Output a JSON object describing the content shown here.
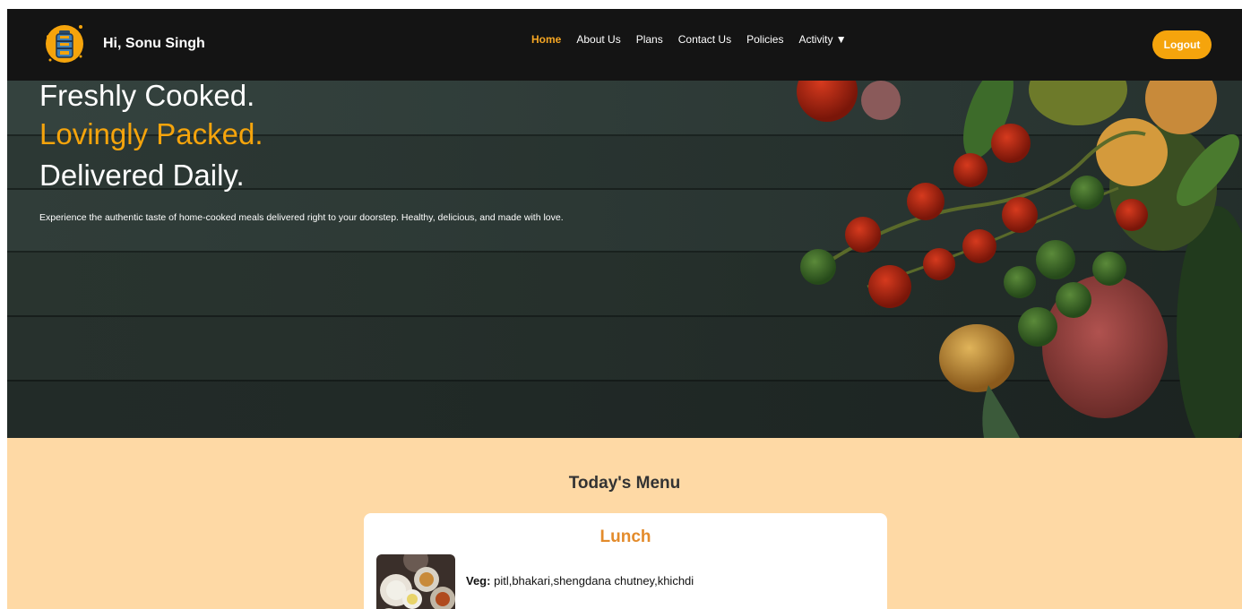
{
  "header": {
    "greeting": "Hi, Sonu Singh",
    "logout_label": "Logout",
    "nav": [
      {
        "label": "Home",
        "active": true
      },
      {
        "label": "About Us",
        "active": false
      },
      {
        "label": "Plans",
        "active": false
      },
      {
        "label": "Contact Us",
        "active": false
      },
      {
        "label": "Policies",
        "active": false
      },
      {
        "label": "Activity ▼",
        "active": false
      }
    ],
    "logo_icon": "lunchbox-icon"
  },
  "hero": {
    "line1": "Freshly Cooked.",
    "line2": "Lovingly Packed.",
    "line3": "Delivered Daily.",
    "description": "Experience the authentic taste of home-cooked meals delivered right to your doorstep. Healthy, delicious, and made with love."
  },
  "menu": {
    "heading": "Today's Menu",
    "card_title": "Lunch",
    "items": [
      {
        "label": "Veg:",
        "value": "pitl,bhakari,shengdana chutney,khichdi"
      }
    ]
  },
  "colors": {
    "accent": "#f5a40c",
    "navbar": "#141414",
    "section_bg": "#fed9a5",
    "card_title": "#e38b2b"
  }
}
